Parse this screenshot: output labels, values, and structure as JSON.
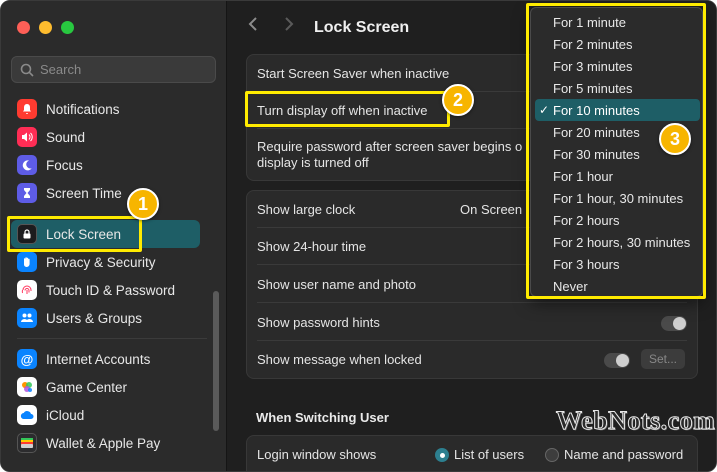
{
  "app": {
    "title": "Lock Screen"
  },
  "search": {
    "placeholder": "Search"
  },
  "sidebar": {
    "items": [
      {
        "label": "Notifications",
        "icon": "bell-icon",
        "color": "#ff3b30"
      },
      {
        "label": "Sound",
        "icon": "speaker-icon",
        "color": "#ff2d55"
      },
      {
        "label": "Focus",
        "icon": "moon-icon",
        "color": "#5e5ce6"
      },
      {
        "label": "Screen Time",
        "icon": "hourglass-icon",
        "color": "#5e5ce6"
      },
      {
        "label": "Lock Screen",
        "icon": "lock-icon",
        "color": "#1c1c1e",
        "selected": true
      },
      {
        "label": "Privacy & Security",
        "icon": "hand-icon",
        "color": "#0a84ff"
      },
      {
        "label": "Touch ID & Password",
        "icon": "fingerprint-icon",
        "color": "#ffffff"
      },
      {
        "label": "Users & Groups",
        "icon": "users-icon",
        "color": "#0a84ff"
      },
      {
        "label": "Internet Accounts",
        "icon": "at-icon",
        "color": "#0a84ff"
      },
      {
        "label": "Game Center",
        "icon": "game-center-icon",
        "color": "#ffffff"
      },
      {
        "label": "iCloud",
        "icon": "cloud-icon",
        "color": "#ffffff"
      },
      {
        "label": "Wallet & Apple Pay",
        "icon": "wallet-icon",
        "color": "#2c2c2e"
      }
    ]
  },
  "settings": {
    "screensaver_label": "Start Screen Saver when inactive",
    "display_off_label": "Turn display off when inactive",
    "require_password_label": "Require password after screen saver begins or display is turned off",
    "require_password_line1": "Require password after screen saver begins o",
    "require_password_line2": "display is turned off",
    "large_clock_label": "Show large clock",
    "large_clock_value": "On Screen",
    "hour24_label": "Show 24-hour time",
    "username_label": "Show user name and photo",
    "password_hints_label": "Show password hints",
    "message_label": "Show message when locked",
    "set_button": "Set...",
    "switching_header": "When Switching User",
    "login_window_label": "Login window shows",
    "list_users_label": "List of users",
    "name_password_label": "Name and password"
  },
  "menu": {
    "options": [
      "For 1 minute",
      "For 2 minutes",
      "For 3 minutes",
      "For 5 minutes",
      "For 10 minutes",
      "For 20 minutes",
      "For 30 minutes",
      "For 1 hour",
      "For 1 hour, 30 minutes",
      "For 2 hours",
      "For 2 hours, 30 minutes",
      "For 3 hours",
      "Never"
    ],
    "selected": "For 10 minutes",
    "check": "✓"
  },
  "annotations": {
    "badge1": "1",
    "badge2": "2",
    "badge3": "3",
    "highlight_color": "#ffeb00",
    "badge_color": "#f7b500"
  },
  "watermark": "WebNots.com"
}
